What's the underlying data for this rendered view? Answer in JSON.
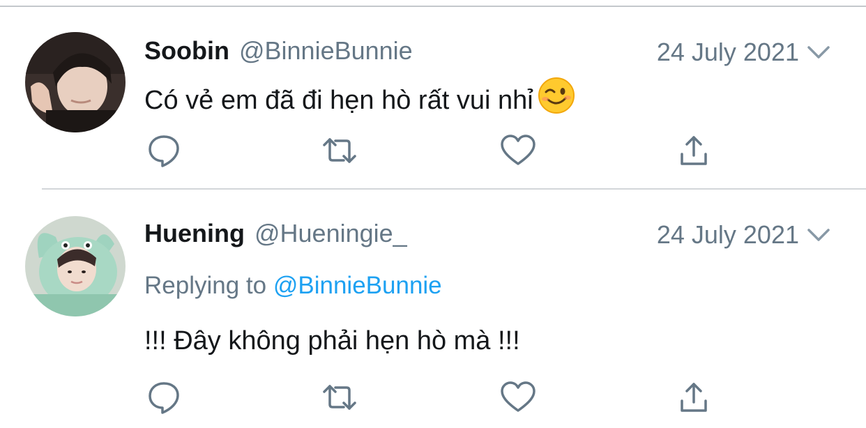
{
  "tweets": [
    {
      "name": "Soobin",
      "handle": "@BinnieBunnie",
      "date": "24 July 2021",
      "text": "Có vẻ em đã đi hẹn hò rất vui nhỉ",
      "emoji": "winking-face-emoji",
      "avatar": "soobin-avatar"
    },
    {
      "name": "Huening",
      "handle": "@Hueningie_",
      "date": "24 July 2021",
      "replying_prefix": "Replying to",
      "replying_to": "@BinnieBunnie",
      "text": "!!! Đây không phải hẹn hò mà !!!",
      "avatar": "huening-avatar"
    }
  ],
  "actions": [
    "reply-icon",
    "retweet-icon",
    "like-icon",
    "share-icon"
  ],
  "colors": {
    "text": "#14171a",
    "secondary": "#657786",
    "link": "#1da1f2",
    "icon": "#657786",
    "divider": "#d3d6d9"
  }
}
